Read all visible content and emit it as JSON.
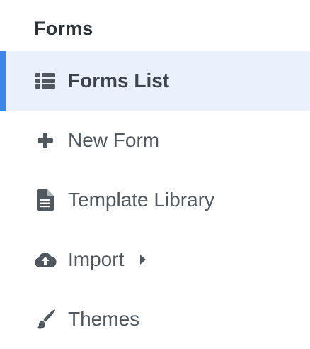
{
  "section": {
    "title": "Forms"
  },
  "menu": {
    "items": [
      {
        "label": "Forms List",
        "icon": "list-icon",
        "active": true
      },
      {
        "label": "New Form",
        "icon": "plus-icon",
        "active": false
      },
      {
        "label": "Template Library",
        "icon": "document-icon",
        "active": false
      },
      {
        "label": "Import",
        "icon": "cloud-upload-icon",
        "active": false,
        "has_submenu": true
      },
      {
        "label": "Themes",
        "icon": "paintbrush-icon",
        "active": false
      }
    ]
  },
  "colors": {
    "accent": "#3b86e6",
    "active_bg": "#e9f1fd",
    "text": "#50575e",
    "icon": "#50575e"
  }
}
